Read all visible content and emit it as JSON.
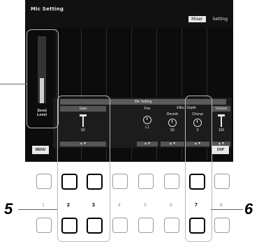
{
  "screen": {
    "title": "Mic Setting",
    "tabs": [
      {
        "label": "Mixer",
        "active": true
      },
      {
        "label": "Setting",
        "active": false
      }
    ],
    "send_level": {
      "label_line1": "Send",
      "label_line2": "Level",
      "level": 0.55
    },
    "panel_header": "Mic Setting",
    "columns": [
      {
        "header": "Gain",
        "control": "slider",
        "value": "50"
      },
      {
        "header": "Pan",
        "control": "knob",
        "value": "L1"
      },
      {
        "header": "Reverb",
        "control": "knob",
        "value": "50",
        "group": "Effect Depth"
      },
      {
        "header": "Chorus",
        "control": "knob",
        "value": "0",
        "group": "Effect Depth"
      },
      {
        "header": "Volume",
        "control": "slider",
        "value": "100"
      }
    ],
    "effect_depth_label": "Effect Depth",
    "arrows": "▲▼",
    "menu_left": "MENU",
    "menu_right": "DSP"
  },
  "buttons": {
    "numbers": [
      "1",
      "2",
      "3",
      "4",
      "5",
      "6",
      "7",
      "8"
    ],
    "highlighted": [
      "2",
      "3",
      "7"
    ]
  },
  "callouts": {
    "left": "5",
    "right": "6"
  }
}
